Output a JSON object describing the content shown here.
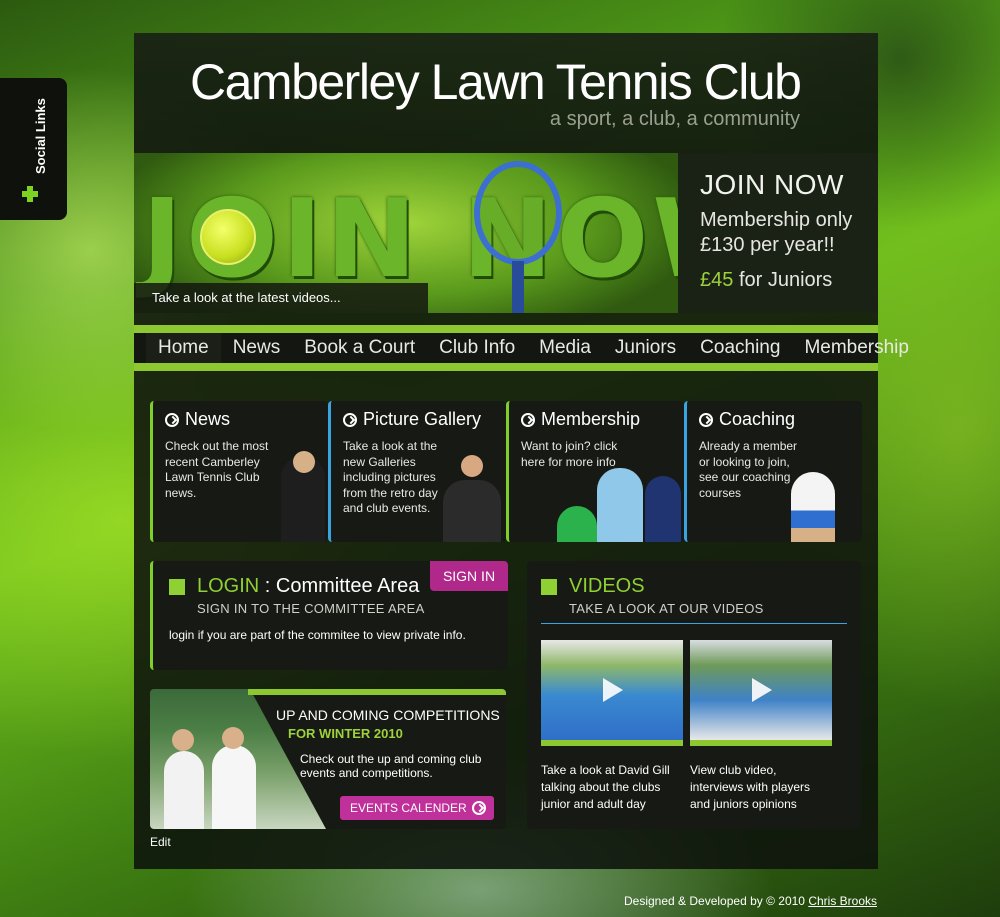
{
  "social": {
    "label": "Social Links"
  },
  "header": {
    "title": "Camberley Lawn Tennis Club",
    "tagline": "a sport, a club, a community"
  },
  "banner": {
    "graphic_text": "JOIN NOW",
    "video_link": "Take a look at the latest videos...",
    "promo_title": "JOIN NOW",
    "promo_line1": "Membership only",
    "promo_price": "£130",
    "promo_per": "per",
    "promo_year": "year",
    "promo_excl": "!!",
    "promo_juniors_price": "£45",
    "promo_juniors_text": "for Juniors"
  },
  "nav": {
    "items": [
      {
        "label": "Home"
      },
      {
        "label": "News"
      },
      {
        "label": "Book a Court"
      },
      {
        "label": "Club Info"
      },
      {
        "label": "Media"
      },
      {
        "label": "Juniors"
      },
      {
        "label": "Coaching"
      },
      {
        "label": "Membership"
      }
    ]
  },
  "features": [
    {
      "title": "News",
      "desc": "Check out the most recent Camberley Lawn Tennis Club news."
    },
    {
      "title": "Picture Gallery",
      "desc": "Take a look at the new Galleries including pictures from the retro day and club events."
    },
    {
      "title": "Membership",
      "desc": "Want to join? click here for more info"
    },
    {
      "title": "Coaching",
      "desc": "Already a member or looking to join, see our coaching courses"
    }
  ],
  "login": {
    "title_green": "LOGIN",
    "title_sep": " : ",
    "title_white": "Committee Area",
    "subtitle": "SIGN IN TO THE COMMITTEE AREA",
    "desc": "login if you are part of the commitee to view private info.",
    "button": "SIGN IN"
  },
  "competitions": {
    "title": "UP AND COMING COMPETITIONS",
    "subtitle": "FOR WINTER 2010",
    "desc": "Check out the up and coming club events and competitions.",
    "button": "EVENTS CALENDER",
    "edit": "Edit"
  },
  "videos": {
    "title": "VIDEOS",
    "subtitle": "TAKE A LOOK AT OUR VIDEOS",
    "items": [
      {
        "desc": "Take a look at David Gill talking about the clubs junior and adult day"
      },
      {
        "desc": "View club video, interviews with players and juniors opinions"
      }
    ]
  },
  "footer": {
    "text": "Designed & Developed by © 2010",
    "author": "Chris Brooks"
  },
  "colors": {
    "accent_green": "#8dc830",
    "accent_blue": "#3aa4e0",
    "accent_magenta": "#b0288a",
    "panel_bg": "#171a14"
  }
}
